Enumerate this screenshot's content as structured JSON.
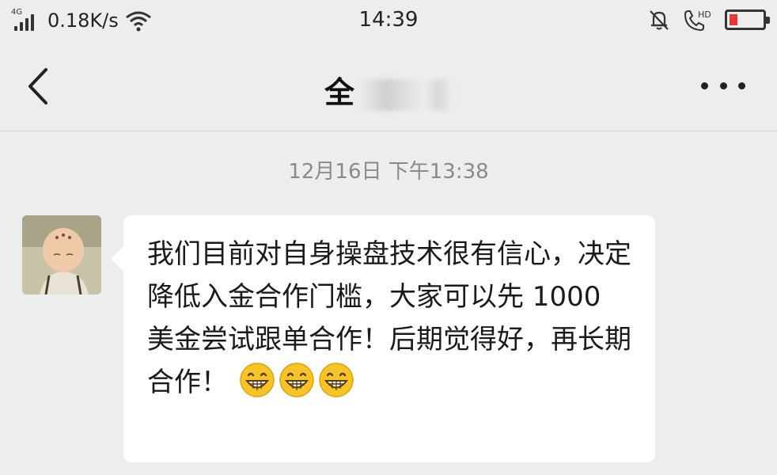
{
  "status_bar": {
    "network_type": "4G",
    "net_speed": "0.18K/s",
    "time": "14:39",
    "hd_label": "HD"
  },
  "nav": {
    "title": "全"
  },
  "conversation": {
    "timestamp": "12月16日 下午13:38",
    "message": {
      "text": "我们目前对自身操盘技术很有信心，决定降低入金合作门槛，大家可以先 1000 美金尝试跟单合作！后期觉得好，再长期合作！",
      "emoji": "grinning-face"
    }
  },
  "colors": {
    "background": "#ededed",
    "bubble": "#ffffff",
    "timestamp_text": "#8a8a8a",
    "battery_level": "#e53935",
    "emoji": "#f7c325"
  }
}
